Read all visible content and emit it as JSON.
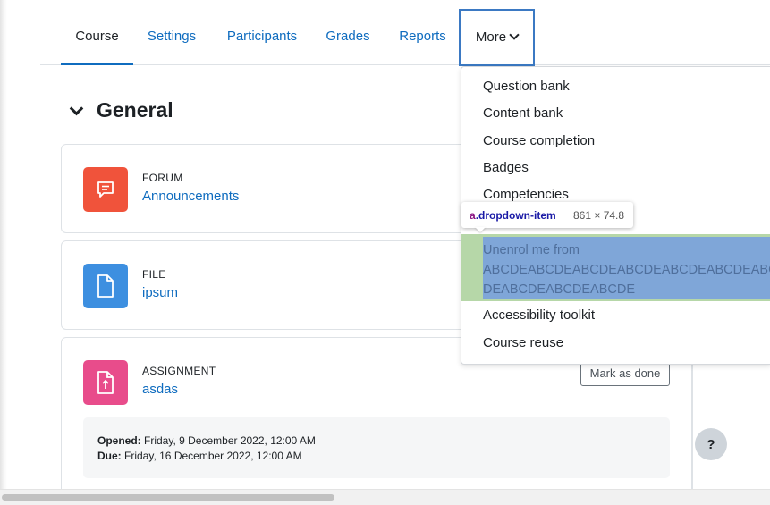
{
  "tabs": [
    {
      "label": "Course"
    },
    {
      "label": "Settings"
    },
    {
      "label": "Participants"
    },
    {
      "label": "Grades"
    },
    {
      "label": "Reports"
    },
    {
      "label": "More"
    }
  ],
  "section": {
    "title": "General"
  },
  "activities": [
    {
      "type": "FORUM",
      "name": "Announcements",
      "icon": "forum-icon",
      "color": "#f0533b"
    },
    {
      "type": "FILE",
      "name": "ipsum",
      "icon": "file-icon",
      "color": "#3d8fe0"
    },
    {
      "type": "ASSIGNMENT",
      "name": "asdas",
      "icon": "assignment-icon",
      "color": "#e84c8b",
      "mark_done_label": "Mark as done",
      "opened_label": "Opened:",
      "opened_value": "Friday, 9 December 2022, 12:00 AM",
      "due_label": "Due:",
      "due_value": "Friday, 16 December 2022, 12:00 AM"
    }
  ],
  "more_menu": {
    "items": [
      "Question bank",
      "Content bank",
      "Course completion",
      "Badges",
      "Competencies"
    ],
    "unenrol_lines": [
      "Unenrol me from",
      "ABCDEABCDEABCDEABCDEABCDEABCDEABCDE",
      "DEABCDEABCDEABCDE"
    ],
    "items_after": [
      "Accessibility toolkit",
      "Course reuse"
    ]
  },
  "devtools_tooltip": {
    "selector_tag": "a",
    "selector_class": ".dropdown-item",
    "dimensions": "861 × 74.8"
  },
  "help_button": {
    "label": "?"
  },
  "colors": {
    "link": "#0f6cbf",
    "highlight_content": "#7fa6d8",
    "highlight_padding": "#b6d7a8"
  }
}
